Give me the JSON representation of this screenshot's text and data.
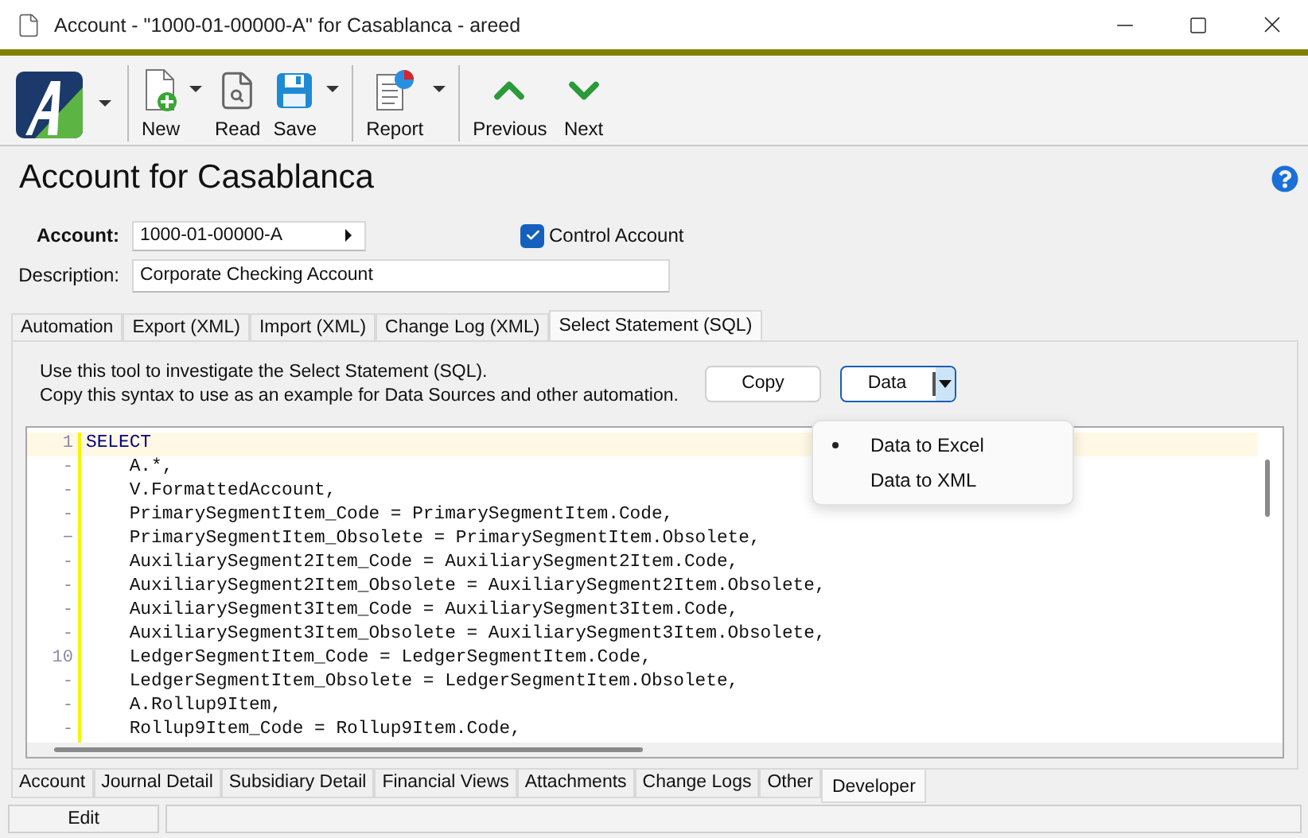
{
  "window": {
    "title": "Account - \"1000-01-00000-A\" for Casablanca - areed"
  },
  "toolbar": {
    "groups": [
      [
        {
          "kind": "logo",
          "dropdown": true
        }
      ],
      [
        {
          "kind": "new",
          "label": "New",
          "dropdown": true
        },
        {
          "kind": "read",
          "label": "Read",
          "dropdown": false
        },
        {
          "kind": "save",
          "label": "Save",
          "dropdown": true
        }
      ],
      [
        {
          "kind": "report",
          "label": "Report",
          "dropdown": true
        }
      ],
      [
        {
          "kind": "previous",
          "label": "Previous",
          "dropdown": false
        },
        {
          "kind": "next",
          "label": "Next",
          "dropdown": false
        }
      ]
    ]
  },
  "heading": "Account for Casablanca",
  "account": {
    "label": "Account:",
    "value": "1000-01-00000-A"
  },
  "control_account": {
    "label": "Control Account",
    "checked": true
  },
  "description": {
    "label": "Description:",
    "value": "Corporate Checking Account"
  },
  "tabs": [
    {
      "label": "Automation",
      "selected": false
    },
    {
      "label": "Export (XML)",
      "selected": false
    },
    {
      "label": "Import (XML)",
      "selected": false
    },
    {
      "label": "Change Log (XML)",
      "selected": false
    },
    {
      "label": "Select Statement (SQL)",
      "selected": true
    }
  ],
  "instructions": [
    "Use this tool to investigate the Select Statement (SQL).",
    "Copy this syntax to use as an example for Data Sources and other automation."
  ],
  "copy_button": "Copy",
  "data_button": "Data",
  "data_menu": [
    {
      "label": "Data to Excel",
      "selected": true
    },
    {
      "label": "Data to XML",
      "selected": false
    }
  ],
  "code_lines": [
    {
      "gutter": "1",
      "text": "SELECT",
      "current": true
    },
    {
      "gutter": "-",
      "text": "    A.*,",
      "current": false
    },
    {
      "gutter": "-",
      "text": "    V.FormattedAccount,",
      "current": false
    },
    {
      "gutter": "-",
      "text": "    PrimarySegmentItem_Code = PrimarySegmentItem.Code,",
      "current": false
    },
    {
      "gutter": "−",
      "text": "    PrimarySegmentItem_Obsolete = PrimarySegmentItem.Obsolete,",
      "current": false
    },
    {
      "gutter": "-",
      "text": "    AuxiliarySegment2Item_Code = AuxiliarySegment2Item.Code,",
      "current": false
    },
    {
      "gutter": "-",
      "text": "    AuxiliarySegment2Item_Obsolete = AuxiliarySegment2Item.Obsolete,",
      "current": false
    },
    {
      "gutter": "-",
      "text": "    AuxiliarySegment3Item_Code = AuxiliarySegment3Item.Code,",
      "current": false
    },
    {
      "gutter": "-",
      "text": "    AuxiliarySegment3Item_Obsolete = AuxiliarySegment3Item.Obsolete,",
      "current": false
    },
    {
      "gutter": "10",
      "text": "    LedgerSegmentItem_Code = LedgerSegmentItem.Code,",
      "current": false
    },
    {
      "gutter": "-",
      "text": "    LedgerSegmentItem_Obsolete = LedgerSegmentItem.Obsolete,",
      "current": false
    },
    {
      "gutter": "-",
      "text": "    A.Rollup9Item,",
      "current": false
    },
    {
      "gutter": "-",
      "text": "    Rollup9Item_Code = Rollup9Item.Code,",
      "current": false
    }
  ],
  "bottom_tabs": [
    {
      "label": "Account",
      "selected": false
    },
    {
      "label": "Journal Detail",
      "selected": false
    },
    {
      "label": "Subsidiary Detail",
      "selected": false
    },
    {
      "label": "Financial Views",
      "selected": false
    },
    {
      "label": "Attachments",
      "selected": false
    },
    {
      "label": "Change Logs",
      "selected": false
    },
    {
      "label": "Other",
      "selected": false
    },
    {
      "label": "Developer",
      "selected": true
    }
  ],
  "status_bar": {
    "mode": "Edit"
  }
}
